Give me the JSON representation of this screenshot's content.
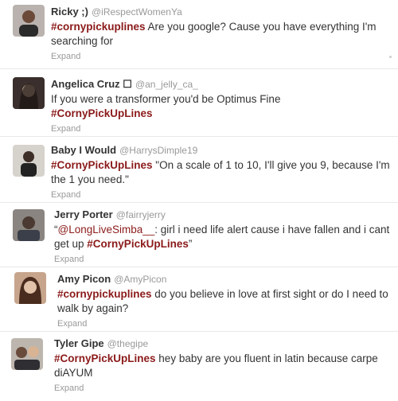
{
  "tweets": [
    {
      "name": "Ricky ;)",
      "handle": "@iRespectWomenYa",
      "hashtag": "#cornypickuplines",
      "text": " Are you google? Cause you have everything I'm searching for",
      "expand": "Expand"
    },
    {
      "name": "Angelica Cruz ☐",
      "handle": "@an_jelly_ca_",
      "text": "If you were a transformer you'd be Optimus Fine",
      "hashtag": "#CornyPickUpLines",
      "expand": "Expand"
    },
    {
      "name": "Baby I Would",
      "handle": "@HarrysDimple19",
      "hashtag": "#CornyPickUpLines",
      "text": " \"On a scale of 1 to 10, I'll give you 9, because I'm the 1 you need.\"",
      "expand": "Expand"
    },
    {
      "name": "Jerry Porter",
      "handle": "@fairryjerry",
      "quote_open": "“",
      "mention": "@LongLiveSimba__",
      "text": ": girl i need life alert cause i have fallen and i cant get up ",
      "hashtag": "#CornyPickUpLines",
      "quote_close": "”",
      "expand": "Expand"
    },
    {
      "name": "Amy Picon",
      "handle": "@AmyPicon",
      "hashtag": "#cornypickuplines",
      "text": " do you believe in love at first sight or do I need to walk by again?",
      "expand": "Expand"
    },
    {
      "name": "Tyler Gipe",
      "handle": "@thegipe",
      "hashtag": "#CornyPickUpLines",
      "text": " hey baby are you fluent in latin because carpe diAYUM",
      "expand": "Expand"
    }
  ]
}
